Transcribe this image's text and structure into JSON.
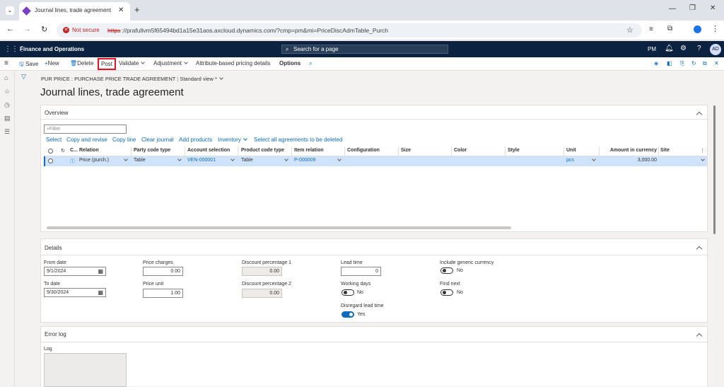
{
  "browser": {
    "tab_title": "Journal lines, trade agreement",
    "new_tab": "+",
    "not_secure": "Not secure",
    "url_scheme": "https",
    "url_rest": "://prafullvm5f65494bd1a15e31aos.axcloud.dynamics.com/?cmp=pm&mi=PriceDiscAdmTable_Purch"
  },
  "app": {
    "name": "Finance and Operations",
    "search_placeholder": "Search for a page",
    "company": "PM",
    "avatar": "AD"
  },
  "actions": {
    "save": "Save",
    "new": "New",
    "delete": "Delete",
    "post": "Post",
    "validate": "Validate",
    "adjustment": "Adjustment",
    "attribute_pricing": "Attribute-based pricing details",
    "options": "Options"
  },
  "page": {
    "breadcrumb": "PUR PRICE : PURCHASE PRICE TRADE AGREEMENT",
    "view": "Standard view *",
    "title": "Journal lines, trade agreement"
  },
  "overview": {
    "header": "Overview",
    "filter_placeholder": "Filter",
    "grid_actions": [
      "Select",
      "Copy and revise",
      "Copy line",
      "Clear journal",
      "Add products",
      "Inventory",
      "Select all agreements to be deleted"
    ],
    "columns": [
      "C...",
      "Relation",
      "Party code type",
      "Account selection",
      "Product code type",
      "Item relation",
      "Configuration",
      "Size",
      "Color",
      "Style",
      "Unit",
      "Amount in currency",
      "Site"
    ],
    "row": {
      "relation": "Price (purch.)",
      "party_code_type": "Table",
      "account_selection": "VEN-000001",
      "product_code_type": "Table",
      "item_relation": "P-000009",
      "unit": "pcs",
      "amount": "3,000.00"
    }
  },
  "details": {
    "header": "Details",
    "from_date_label": "From date",
    "from_date": "9/1/2024",
    "to_date_label": "To date",
    "to_date": "9/30/2024",
    "price_charges_label": "Price charges",
    "price_charges": "0.00",
    "price_unit_label": "Price unit",
    "price_unit": "1.00",
    "disc1_label": "Discount percentage 1",
    "disc1": "0.00",
    "disc2_label": "Discount percentage 2",
    "disc2": "0.00",
    "lead_time_label": "Lead time",
    "lead_time": "0",
    "working_days_label": "Working days",
    "working_days": "No",
    "disregard_label": "Disregard lead time",
    "disregard": "Yes",
    "generic_currency_label": "Include generic currency",
    "generic_currency": "No",
    "find_next_label": "Find next",
    "find_next": "No"
  },
  "error_log": {
    "header": "Error log",
    "log_label": "Log"
  },
  "colors": {
    "nav_bg": "#0b2341",
    "accent": "#0f6cbd",
    "selected_row": "#cfe4fa",
    "post_highlight": "#e81123"
  }
}
